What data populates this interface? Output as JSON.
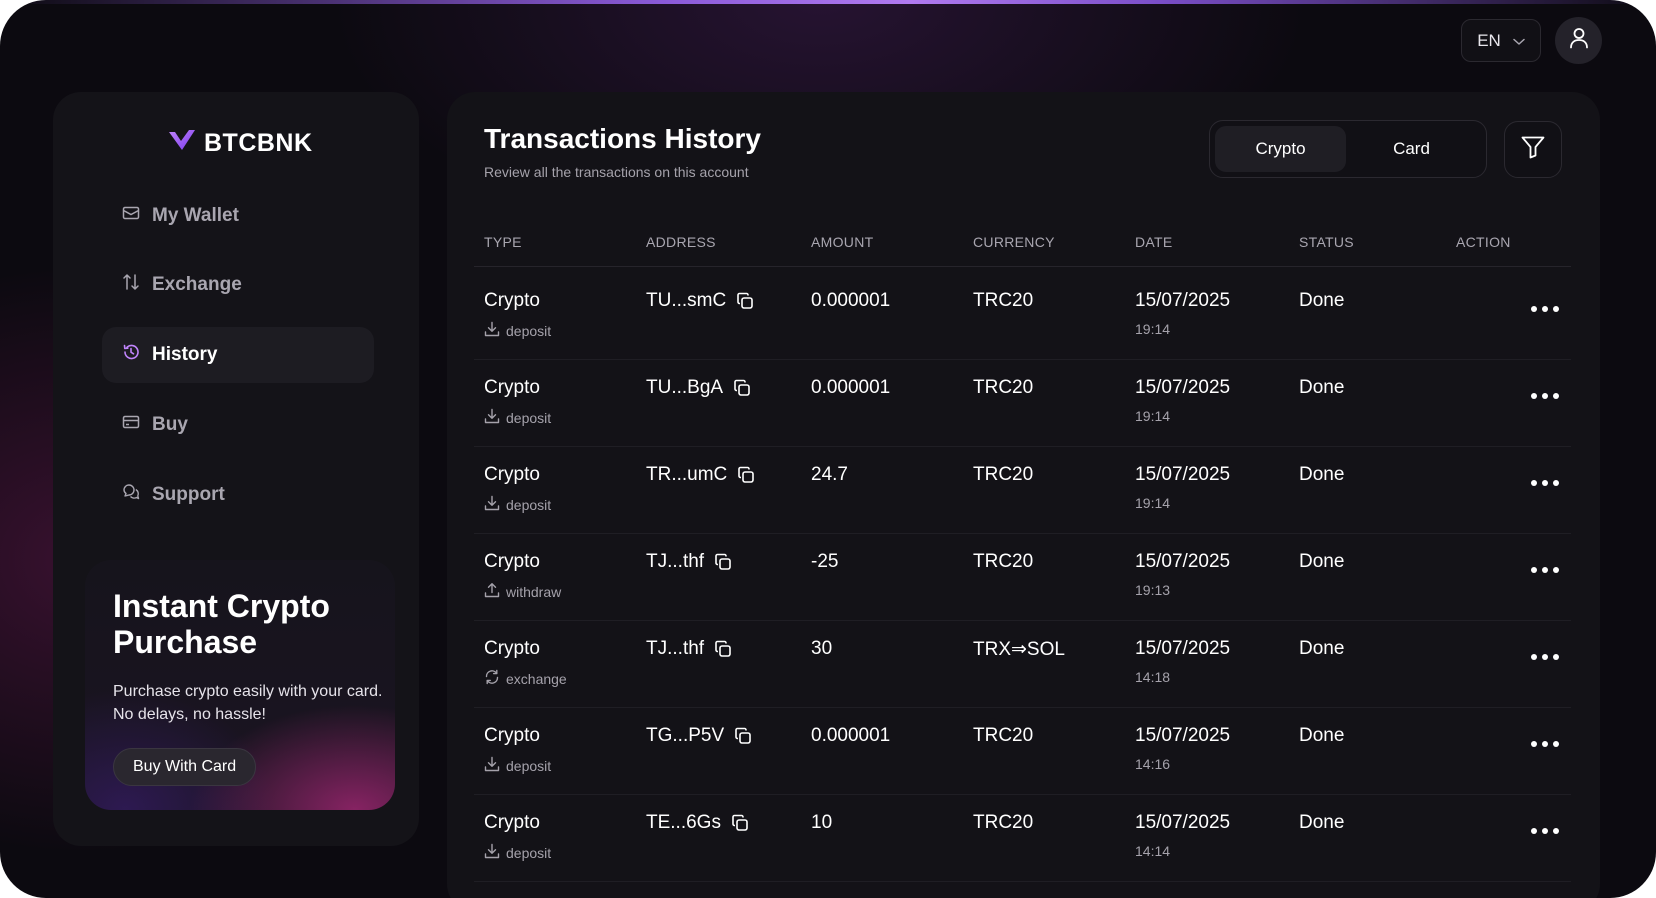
{
  "topbar": {
    "language": "EN"
  },
  "sidebar": {
    "brand": "BTCBNK",
    "items": [
      {
        "label": "My Wallet",
        "icon": "wallet-icon"
      },
      {
        "label": "Exchange",
        "icon": "arrows-swap-icon"
      },
      {
        "label": "History",
        "icon": "history-icon",
        "active": true
      },
      {
        "label": "Buy",
        "icon": "card-icon"
      },
      {
        "label": "Support",
        "icon": "chat-icon"
      }
    ],
    "promo": {
      "title": "Instant Crypto Purchase",
      "text": "Purchase crypto easily with your card. No delays, no hassle!",
      "button": "Buy With Card"
    }
  },
  "main": {
    "title": "Transactions History",
    "subtitle": "Review all the transactions on this account",
    "tabs": [
      {
        "label": "Crypto",
        "active": true
      },
      {
        "label": "Card",
        "active": false
      }
    ],
    "columns": [
      "TYPE",
      "ADDRESS",
      "AMOUNT",
      "CURRENCY",
      "DATE",
      "STATUS",
      "ACTION"
    ],
    "rows": [
      {
        "type": "Crypto",
        "kind": "deposit",
        "address": "TU...smC",
        "amount": "0.000001",
        "currency": "TRC20",
        "date": "15/07/2025",
        "time": "19:14",
        "status": "Done"
      },
      {
        "type": "Crypto",
        "kind": "deposit",
        "address": "TU...BgA",
        "amount": "0.000001",
        "currency": "TRC20",
        "date": "15/07/2025",
        "time": "19:14",
        "status": "Done"
      },
      {
        "type": "Crypto",
        "kind": "deposit",
        "address": "TR...umC",
        "amount": "24.7",
        "currency": "TRC20",
        "date": "15/07/2025",
        "time": "19:14",
        "status": "Done"
      },
      {
        "type": "Crypto",
        "kind": "withdraw",
        "address": "TJ...thf",
        "amount": "-25",
        "currency": "TRC20",
        "date": "15/07/2025",
        "time": "19:13",
        "status": "Done"
      },
      {
        "type": "Crypto",
        "kind": "exchange",
        "address": "TJ...thf",
        "amount": "30",
        "currency": "TRX⇒SOL",
        "date": "15/07/2025",
        "time": "14:18",
        "status": "Done"
      },
      {
        "type": "Crypto",
        "kind": "deposit",
        "address": "TG...P5V",
        "amount": "0.000001",
        "currency": "TRC20",
        "date": "15/07/2025",
        "time": "14:16",
        "status": "Done"
      },
      {
        "type": "Crypto",
        "kind": "deposit",
        "address": "TE...6Gs",
        "amount": "10",
        "currency": "TRC20",
        "date": "15/07/2025",
        "time": "14:14",
        "status": "Done"
      }
    ]
  },
  "colors": {
    "background": "#0c0a10",
    "panel": "#131217",
    "accent": "#a855f7",
    "muted_text": "#a9a6b0"
  }
}
